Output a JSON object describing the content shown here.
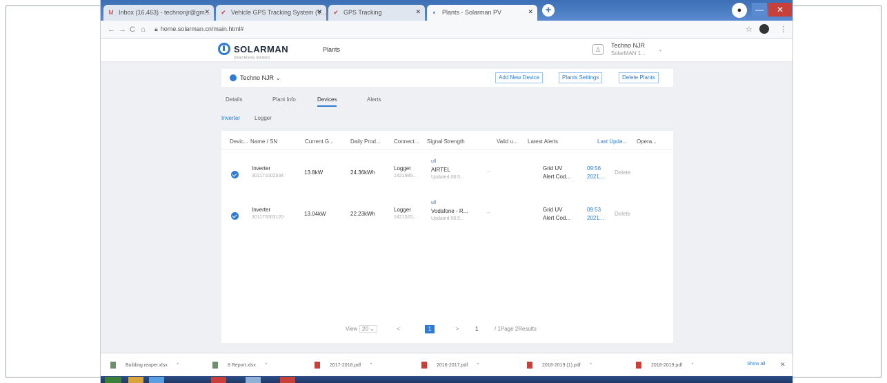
{
  "browser": {
    "tabs": [
      {
        "label": "Inbox (16,463) - technonjr@gm...",
        "favicon": "M",
        "color": "#c9403a"
      },
      {
        "label": "Vehicle GPS Tracking System (V...",
        "favicon": "✔",
        "color": "#c9403a"
      },
      {
        "label": "GPS Tracking",
        "favicon": "✔",
        "color": "#c9403a"
      },
      {
        "label": "Plants - Solarman PV",
        "favicon": "◐",
        "color": "#2e7bd6"
      }
    ],
    "new_tab": "+",
    "url": "home.solarman.cn/main.html#",
    "nav": {
      "back": "←",
      "forward": "→",
      "reload": "C",
      "home": "⌂"
    },
    "star": "☆",
    "menu": "⋮",
    "window_minimize": "—",
    "window_close": "✕"
  },
  "header": {
    "logo": "SOLARMAN",
    "logo_sub": "Smart Energy Solutions",
    "nav_plants": "Plants",
    "user_name": "Techno NJR",
    "user_sub": "SolarMAN 1...",
    "user_icon": "♙",
    "user_caret": "⌄"
  },
  "plant": {
    "name": "Techno NJR ⌄",
    "buttons": {
      "add": "Add New Device",
      "settings": "Plants Settings",
      "delete": "Delete Plants"
    }
  },
  "tabs": {
    "details": "Details",
    "plant_info": "Plant Info",
    "devices": "Devices",
    "alerts": "Alerts"
  },
  "subtabs": {
    "inverter": "Inverter",
    "logger": "Logger"
  },
  "table": {
    "headers": {
      "device": "Devic...",
      "name": "Name / SN",
      "current": "Current G...",
      "daily": "Daily Prod...",
      "connect": "Connect...",
      "signal": "Signal Strength",
      "valid": "Valid u...",
      "alerts": "Latest Alerts",
      "last_update": "Last Upda...",
      "operation": "Opera..."
    },
    "rows": [
      {
        "name": "Inverter",
        "sn": "301171002534",
        "current": "13.8kW",
        "daily": "24.36kWh",
        "connect": "Logger",
        "connect_sn": "1421989...",
        "signal_icon": "ull",
        "signal": "AIRTEL",
        "signal_updated": "Updated 08:5...",
        "valid": "--",
        "alert_1": "Grid UV",
        "alert_2": "Alert Cod...",
        "update_time": "09:56",
        "update_year": "2021...",
        "operation": "Delete"
      },
      {
        "name": "Inverter",
        "sn": "301175003120",
        "current": "13.04kW",
        "daily": "22.23kWh",
        "connect": "Logger",
        "connect_sn": "1421520...",
        "signal_icon": "ull",
        "signal": "Vodafone - R...",
        "signal_updated": "Updated 08:5...",
        "valid": "--",
        "alert_1": "Grid UV",
        "alert_2": "Alert Cod...",
        "update_time": "09:53",
        "update_year": "2021...",
        "operation": "Delete"
      }
    ]
  },
  "pager": {
    "view_label": "View",
    "view_value": "20",
    "caret": "⌄",
    "prev": "<",
    "current_page": "1",
    "next": ">",
    "goto_value": "1",
    "summary": "/ 1Page 2Results"
  },
  "downloads": [
    {
      "label": "Building reaper.xlsx",
      "type": "doc"
    },
    {
      "label": "8 Report.xlsx",
      "type": "doc"
    },
    {
      "label": "2017-2018.pdf",
      "type": "pdf"
    },
    {
      "label": "2016-2017.pdf",
      "type": "pdf"
    },
    {
      "label": "2018-2019 (1).pdf",
      "type": "pdf"
    },
    {
      "label": "2018-2019.pdf",
      "type": "pdf"
    }
  ],
  "download_caret": "⌃",
  "show_all": "Show all",
  "download_close": "✕"
}
